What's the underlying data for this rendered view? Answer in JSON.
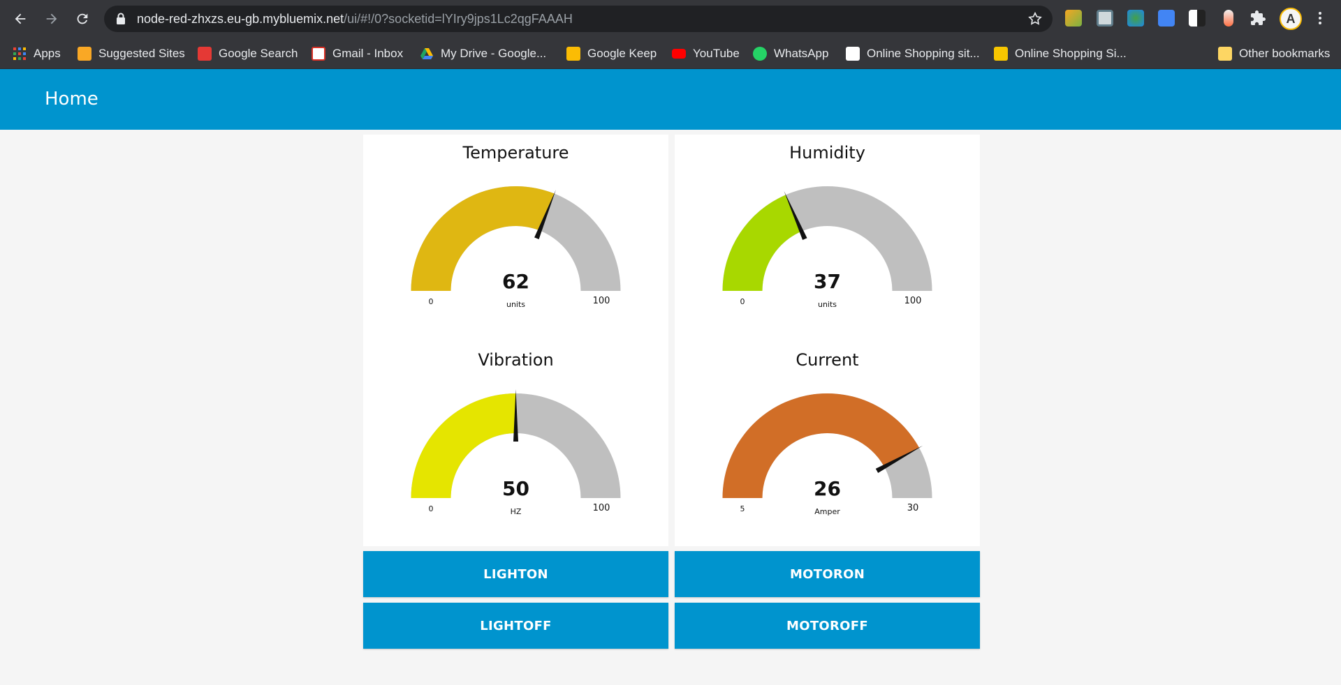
{
  "browser": {
    "url_host": "node-red-zhxzs.eu-gb.mybluemix.net",
    "url_path": "/ui/#!/0?socketid=lYIry9jps1Lc2qgFAAAH",
    "back_icon": "arrow-left-icon",
    "forward_icon": "arrow-right-icon",
    "reload_icon": "reload-icon"
  },
  "bookmarks": {
    "items": [
      {
        "label": "Apps",
        "color": "#ea4335"
      },
      {
        "label": "Suggested Sites",
        "color": "#f9a825"
      },
      {
        "label": "Google Search",
        "color": "#e53935"
      },
      {
        "label": "Gmail - Inbox",
        "color": "#d93025"
      },
      {
        "label": "My Drive - Google...",
        "color": "#1fa463"
      },
      {
        "label": "Google Keep",
        "color": "#fbbc04"
      },
      {
        "label": "YouTube",
        "color": "#ff0000"
      },
      {
        "label": "WhatsApp",
        "color": "#25d366"
      },
      {
        "label": "Online Shopping sit...",
        "color": "#ffffff"
      },
      {
        "label": "Online Shopping Si...",
        "color": "#f7c600"
      }
    ],
    "more": "»",
    "other": "Other bookmarks"
  },
  "header": {
    "title": "Home",
    "color": "#0094ce"
  },
  "gauges": [
    {
      "title": "Temperature",
      "value": 62,
      "units": "units",
      "min": "0",
      "max": "100",
      "fraction": 0.62,
      "color": "#dfb712"
    },
    {
      "title": "Humidity",
      "value": 37,
      "units": "units",
      "min": "0",
      "max": "100",
      "fraction": 0.37,
      "color": "#a8d800"
    },
    {
      "title": "Vibration",
      "value": 50,
      "units": "HZ",
      "min": "0",
      "max": "100",
      "fraction": 0.5,
      "color": "#e5e500"
    },
    {
      "title": "Current",
      "value": 26,
      "units": "Amper",
      "min": "5",
      "max": "30",
      "fraction": 0.84,
      "color": "#d16e27"
    }
  ],
  "buttons": {
    "light_on": "LIGHTON",
    "motor_on": "MOTORON",
    "light_off": "LIGHTOFF",
    "motor_off": "MOTOROFF"
  }
}
